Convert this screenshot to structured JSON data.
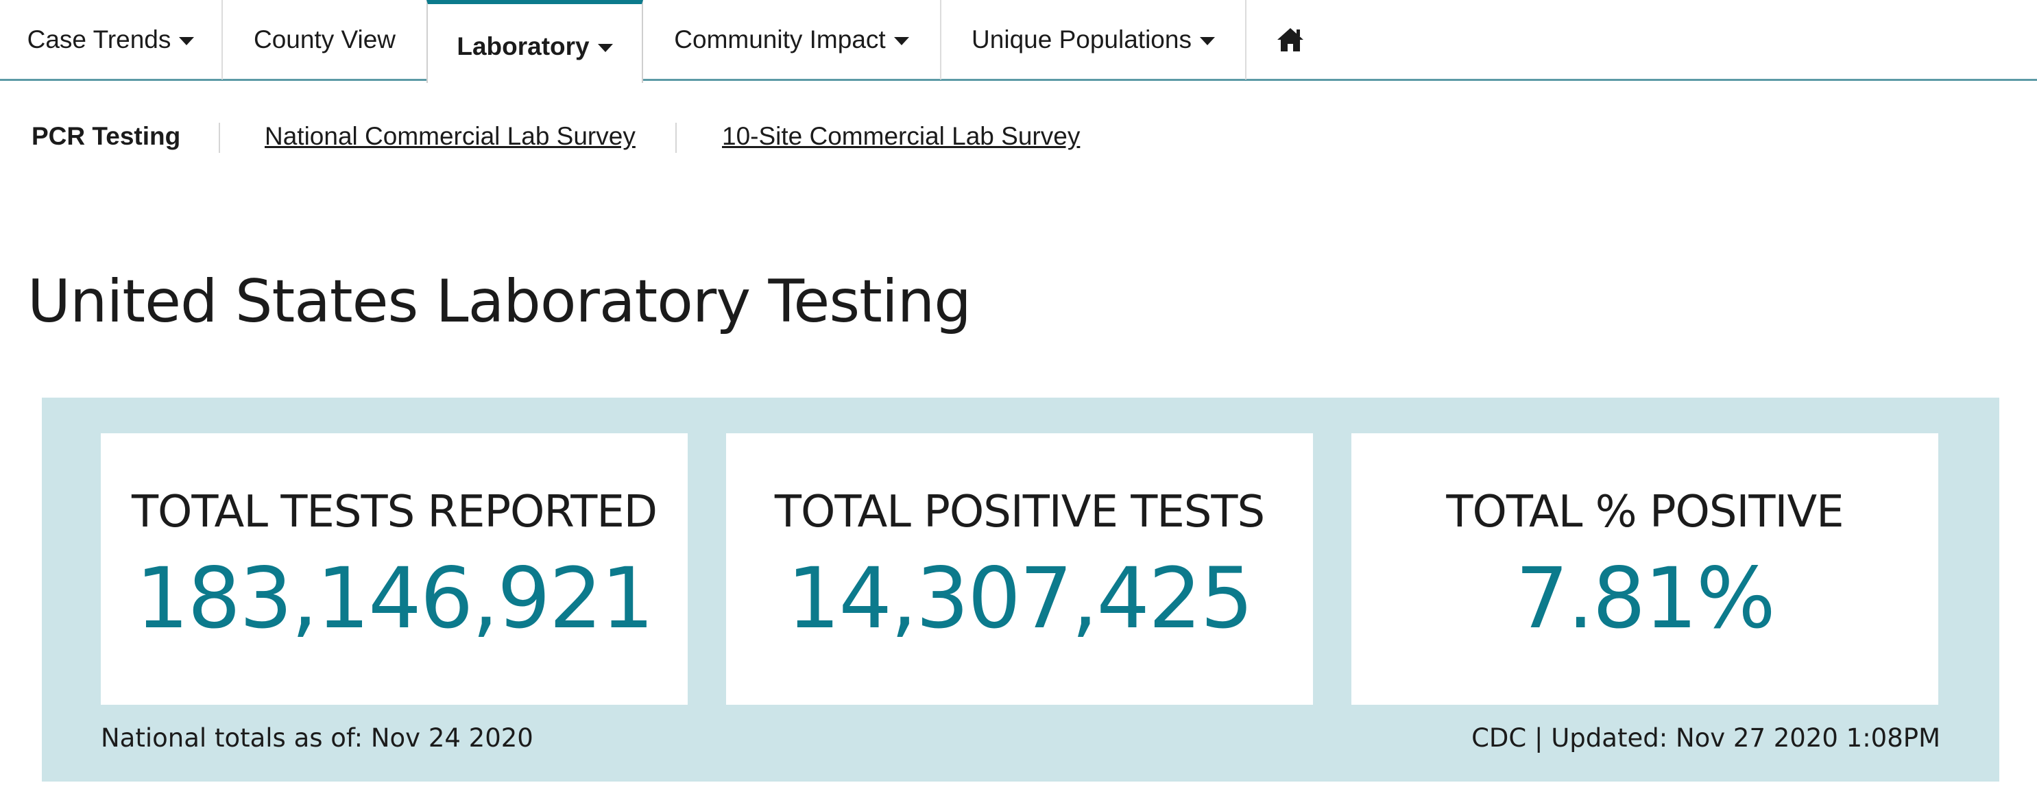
{
  "topnav": {
    "tabs": [
      {
        "label": "Case Trends",
        "dropdown": true
      },
      {
        "label": "County View",
        "dropdown": false
      },
      {
        "label": "Laboratory",
        "dropdown": true,
        "active": true
      },
      {
        "label": "Community Impact",
        "dropdown": true
      },
      {
        "label": "Unique Populations",
        "dropdown": true
      }
    ],
    "home_icon": "home-icon"
  },
  "subnav": {
    "items": [
      {
        "label": "PCR Testing",
        "current": true
      },
      {
        "label": "National Commercial Lab Survey",
        "current": false
      },
      {
        "label": "10-Site Commercial Lab Survey",
        "current": false
      }
    ]
  },
  "page": {
    "title": "United States Laboratory Testing"
  },
  "stats": {
    "cards": [
      {
        "label": "TOTAL TESTS REPORTED",
        "value": "183,146,921"
      },
      {
        "label": "TOTAL POSITIVE TESTS",
        "value": "14,307,425"
      },
      {
        "label": "TOTAL % POSITIVE",
        "value": "7.81%"
      }
    ],
    "as_of": "National totals as of: Nov 24 2020",
    "updated": "CDC | Updated: Nov 27 2020 1:08PM"
  },
  "colors": {
    "accent": "#0c7a8c",
    "panel_bg": "#cce4e8",
    "nav_border": "#5c9aa6"
  }
}
